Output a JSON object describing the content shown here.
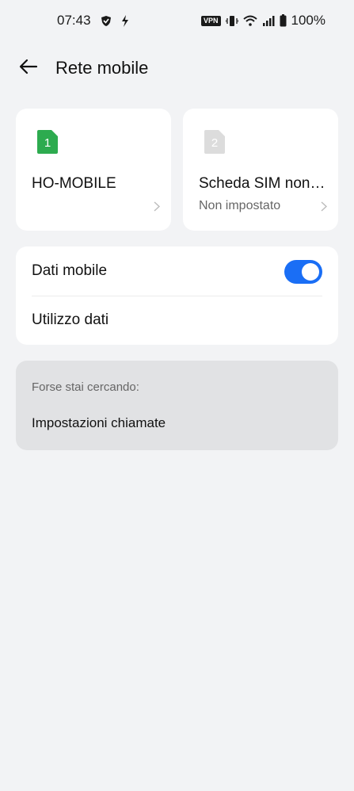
{
  "status_bar": {
    "time": "07:43",
    "vpn_label": "VPN",
    "battery": "100%",
    "icons": [
      "shield-icon",
      "bolt-icon",
      "vibrate-icon",
      "wifi-icon",
      "signal-icon",
      "battery-icon"
    ]
  },
  "app_bar": {
    "title": "Rete mobile",
    "back_icon": "arrow-left-icon"
  },
  "sims": [
    {
      "slot": "1",
      "name": "HO-MOBILE",
      "subtitle": "",
      "color": "#2dab4f",
      "active": true
    },
    {
      "slot": "2",
      "name": "Scheda SIM non inserita",
      "subtitle": "Non impostato",
      "color": "#dcdcdc",
      "active": false
    }
  ],
  "settings": {
    "mobile_data_label": "Dati mobile",
    "mobile_data_on": true,
    "data_usage_label": "Utilizzo dati"
  },
  "suggestions": {
    "header": "Forse stai cercando:",
    "items": [
      "Impostazioni chiamate"
    ]
  },
  "colors": {
    "accent": "#1a6ef5",
    "background": "#f2f3f5",
    "card": "#ffffff",
    "suggest_card": "#e1e2e4"
  }
}
